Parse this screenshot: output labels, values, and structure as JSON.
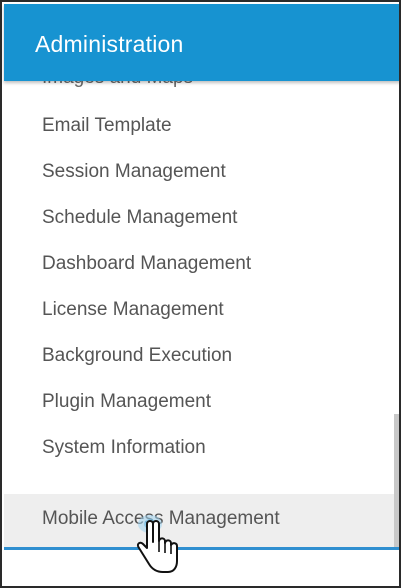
{
  "header": {
    "title": "Administration"
  },
  "menu": {
    "partial_item": "Images and Maps",
    "items": [
      "Email Template",
      "Session Management",
      "Schedule Management",
      "Dashboard Management",
      "License Management",
      "Background Execution",
      "Plugin Management",
      "System Information",
      "Mobile Access Management"
    ],
    "hovered_item": "Mobile Access Management"
  },
  "cursor": {
    "icon": "hand-pointer-icon"
  },
  "colors": {
    "header_bg": "#1793d1",
    "header_text": "#ffffff",
    "item_text": "#555555",
    "hover_bg": "#eeeeee",
    "accent_line": "#2f8fd0"
  }
}
